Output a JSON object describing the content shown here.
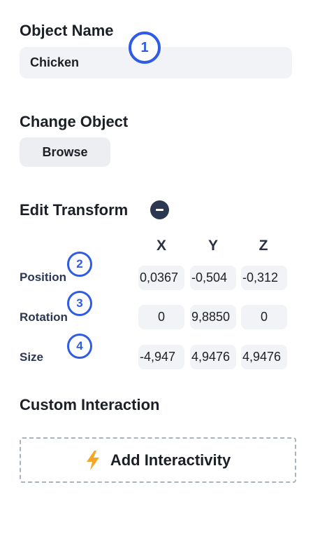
{
  "object_name": {
    "heading": "Object Name",
    "value": "Chicken"
  },
  "change_object": {
    "heading": "Change Object",
    "browse_label": "Browse"
  },
  "edit_transform": {
    "heading": "Edit Transform",
    "axes": [
      "X",
      "Y",
      "Z"
    ],
    "rows": [
      {
        "label": "Position",
        "values": [
          "0,0367",
          "-0,504",
          "-0,312"
        ]
      },
      {
        "label": "Rotation",
        "values": [
          "0",
          "9,8850",
          "0"
        ]
      },
      {
        "label": "Size",
        "values": [
          "-4,947",
          "4,9476",
          "4,9476"
        ]
      }
    ]
  },
  "custom_interaction": {
    "heading": "Custom Interaction",
    "add_label": "Add Interactivity",
    "icon": "lightning-icon"
  },
  "callouts": [
    "1",
    "2",
    "3",
    "4"
  ],
  "colors": {
    "accent": "#2f5be5",
    "collapse": "#2c3852",
    "bolt": "#f5a623"
  }
}
